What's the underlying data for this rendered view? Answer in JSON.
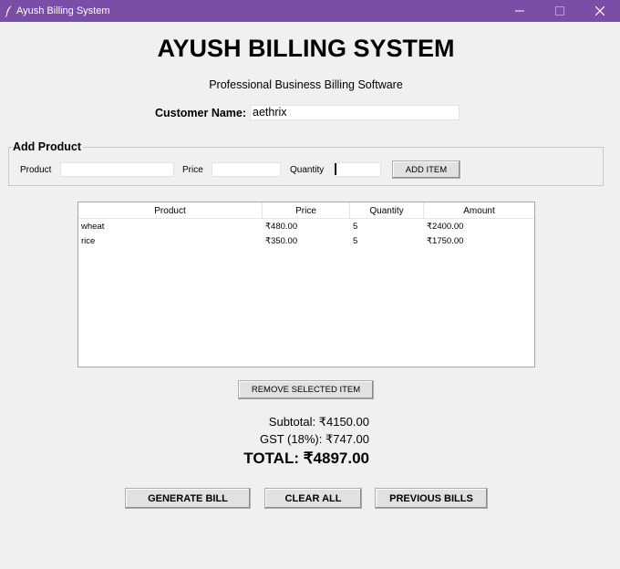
{
  "window": {
    "title": "Ayush Billing System"
  },
  "header": {
    "title": "AYUSH BILLING SYSTEM",
    "subtitle": "Professional Business Billing Software"
  },
  "customer": {
    "label": "Customer Name:",
    "value": "aethrix"
  },
  "add_product": {
    "legend": "Add Product",
    "product_label": "Product",
    "product_value": "",
    "price_label": "Price",
    "price_value": "",
    "quantity_label": "Quantity",
    "quantity_value": "",
    "add_button": "ADD ITEM"
  },
  "table": {
    "columns": [
      "Product",
      "Price",
      "Quantity",
      "Amount"
    ],
    "rows": [
      [
        "wheat",
        "₹480.00",
        "5",
        "₹2400.00"
      ],
      [
        "rice",
        "₹350.00",
        "5",
        "₹1750.00"
      ]
    ]
  },
  "remove_button": "REMOVE SELECTED ITEM",
  "totals": {
    "subtotal": "Subtotal: ₹4150.00",
    "gst": "GST (18%): ₹747.00",
    "total": "TOTAL: ₹4897.00"
  },
  "actions": {
    "generate": "GENERATE BILL",
    "clear": "CLEAR ALL",
    "previous": "PREVIOUS BILLS"
  },
  "colors": {
    "titlebar": "#7a4ea6",
    "background": "#f0f0f0"
  },
  "icons": {
    "app": "feather-icon",
    "minimize": "minimize-icon",
    "maximize": "maximize-icon",
    "close": "close-icon"
  }
}
